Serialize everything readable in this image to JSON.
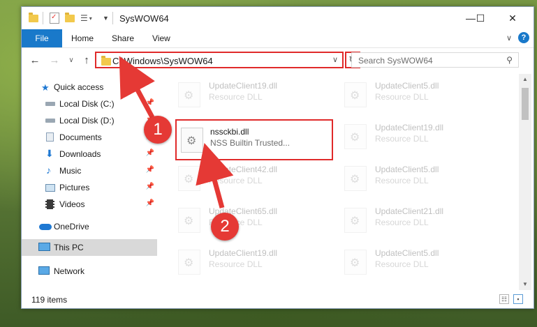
{
  "window": {
    "title": "SysWOW64",
    "controls": {
      "minimize": "—",
      "maximize": "☐",
      "close": "✕"
    }
  },
  "ribbon": {
    "tabs": [
      "File",
      "Home",
      "Share",
      "View"
    ],
    "expand": "∨",
    "help": "?"
  },
  "nav": {
    "back": "←",
    "forward": "→",
    "recent": "∨",
    "up": "↑",
    "address": "C:\\Windows\\SysWOW64",
    "address_dropdown": "∨",
    "refresh": "↻",
    "search_placeholder": "Search SysWOW64",
    "search_icon": "⚲"
  },
  "sidebar": {
    "items": [
      {
        "label": "Quick access",
        "icon": "star-icon",
        "pinned": false
      },
      {
        "label": "Local Disk (C:)",
        "icon": "drive-icon",
        "pinned": true
      },
      {
        "label": "Local Disk (D:)",
        "icon": "drive-icon",
        "pinned": true
      },
      {
        "label": "Documents",
        "icon": "documents-icon",
        "pinned": true
      },
      {
        "label": "Downloads",
        "icon": "downloads-icon",
        "pinned": true
      },
      {
        "label": "Music",
        "icon": "music-icon",
        "pinned": true
      },
      {
        "label": "Pictures",
        "icon": "pictures-icon",
        "pinned": true
      },
      {
        "label": "Videos",
        "icon": "videos-icon",
        "pinned": true
      },
      {
        "label": "OneDrive",
        "icon": "onedrive-icon",
        "pinned": false
      },
      {
        "label": "This PC",
        "icon": "computer-icon",
        "pinned": false,
        "selected": true
      },
      {
        "label": "Network",
        "icon": "network-icon",
        "pinned": false
      }
    ],
    "pin_glyph": "📌"
  },
  "files": {
    "left_column": [
      {
        "name": "UpdateClient19.dll",
        "desc": "Resource DLL"
      },
      {
        "name": "nssckbi.dll",
        "desc": "NSS Builtin Trusted...",
        "highlighted": true
      },
      {
        "name": "UpdateClient42.dll",
        "desc": "Resource DLL"
      },
      {
        "name": "UpdateClient65.dll",
        "desc": "Resource DLL"
      },
      {
        "name": "UpdateClient19.dll",
        "desc": "Resource DLL"
      }
    ],
    "right_column": [
      {
        "name": "UpdateClient5.dll",
        "desc": "Resource DLL"
      },
      {
        "name": "UpdateClient19.dll",
        "desc": "Resource DLL"
      },
      {
        "name": "UpdateClient5.dll",
        "desc": "Resource DLL"
      },
      {
        "name": "UpdateClient21.dll",
        "desc": "Resource DLL"
      },
      {
        "name": "UpdateClient5.dll",
        "desc": "Resource DLL"
      }
    ]
  },
  "status": {
    "item_count": "119 items"
  },
  "annotations": {
    "step1": "1",
    "step2": "2",
    "color": "#e53935"
  }
}
